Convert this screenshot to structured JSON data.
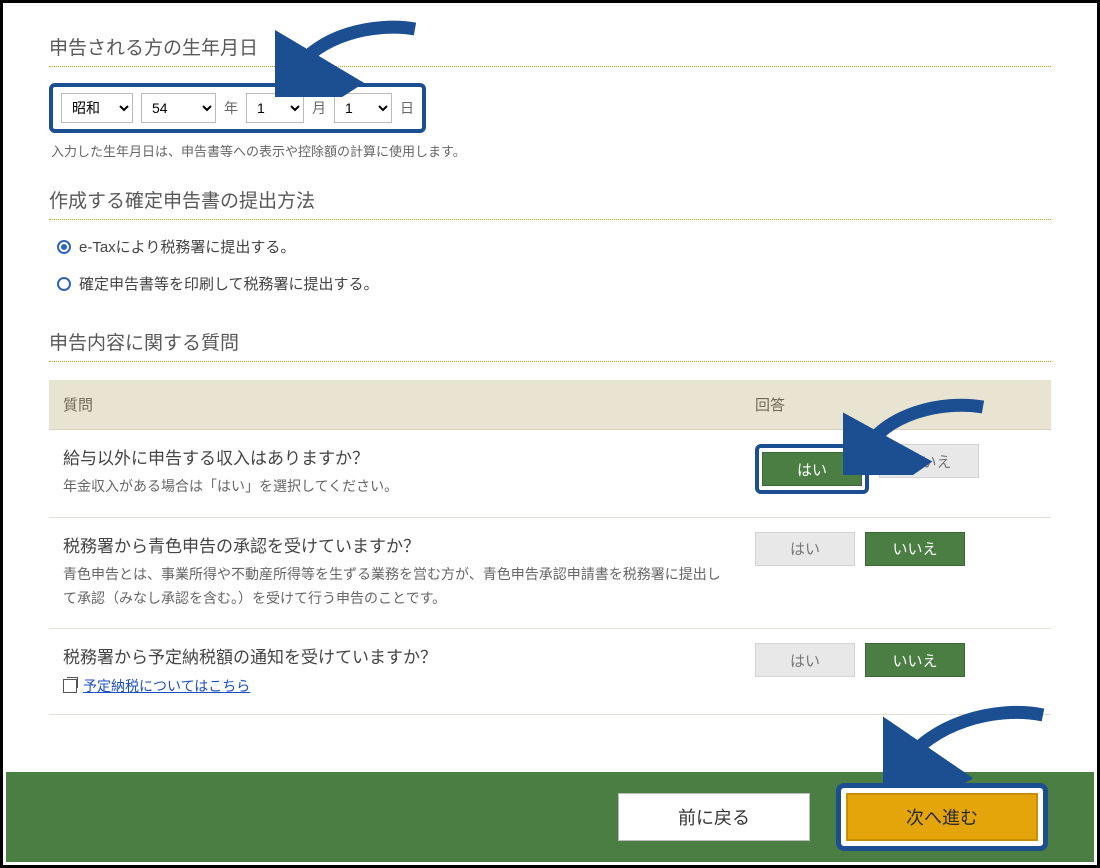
{
  "sections": {
    "dob": {
      "title": "申告される方の生年月日",
      "era_value": "昭和",
      "year_value": "54",
      "year_unit": "年",
      "month_value": "1",
      "month_unit": "月",
      "day_value": "1",
      "day_unit": "日",
      "note": "入力した生年月日は、申告書等への表示や控除額の計算に使用します。"
    },
    "submit_method": {
      "title": "作成する確定申告書の提出方法",
      "opt1": "e-Taxにより税務署に提出する。",
      "opt2": "確定申告書等を印刷して税務署に提出する。"
    },
    "questions": {
      "title": "申告内容に関する質問",
      "hdr_q": "質問",
      "hdr_a": "回答",
      "yes": "はい",
      "no": "いいえ",
      "q1_main": "給与以外に申告する収入はありますか？",
      "q1_sub": "年金収入がある場合は「はい」を選択してください。",
      "q2_main": "税務署から青色申告の承認を受けていますか？",
      "q2_sub": "青色申告とは、事業所得や不動産所得等を生ずる業務を営む方が、青色申告承認申請書を税務署に提出して承認（みなし承認を含む。）を受けて行う申告のことです。",
      "q3_main": "税務署から予定納税額の通知を受けていますか？",
      "q3_link": "予定納税についてはこちら"
    }
  },
  "footer": {
    "back": "前に戻る",
    "next": "次へ進む"
  }
}
